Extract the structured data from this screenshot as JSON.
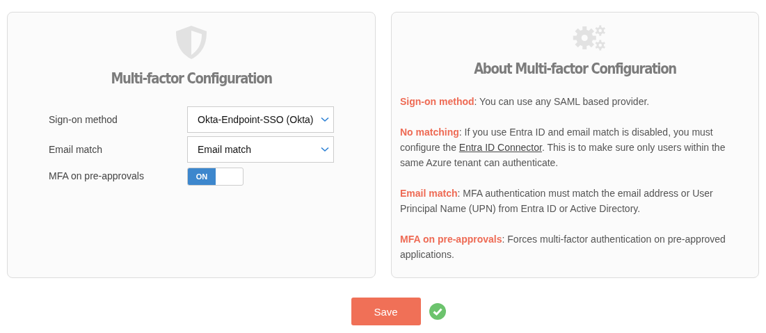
{
  "config_panel": {
    "title": "Multi-factor Configuration",
    "fields": [
      {
        "kind": "select",
        "label": "Sign-on method",
        "value": "Okta-Endpoint-SSO (Okta)"
      },
      {
        "kind": "select",
        "label": "Email match",
        "value": "Email match"
      },
      {
        "kind": "toggle",
        "label": "MFA on pre-approvals",
        "on": true,
        "on_label": "ON"
      }
    ]
  },
  "about_panel": {
    "title": "About Multi-factor Configuration",
    "paragraphs": [
      {
        "term": "Sign-on method",
        "text": ": You can use any SAML based provider."
      },
      {
        "term": "No matching",
        "text": ": If you use Entra ID and email match is disabled, you must configure the ",
        "link": "Entra ID Connector",
        "after": ". This is to make sure only users within the same Azure tenant can authenticate."
      },
      {
        "term": "Email match",
        "text": ": MFA authentication must match the email address or User Principal Name (UPN) from Entra ID or Active Directory."
      },
      {
        "term": "MFA on pre-approvals",
        "text": ": Forces multi-factor authentication on pre-approved applications."
      }
    ]
  },
  "save_button": "Save",
  "saved": true
}
